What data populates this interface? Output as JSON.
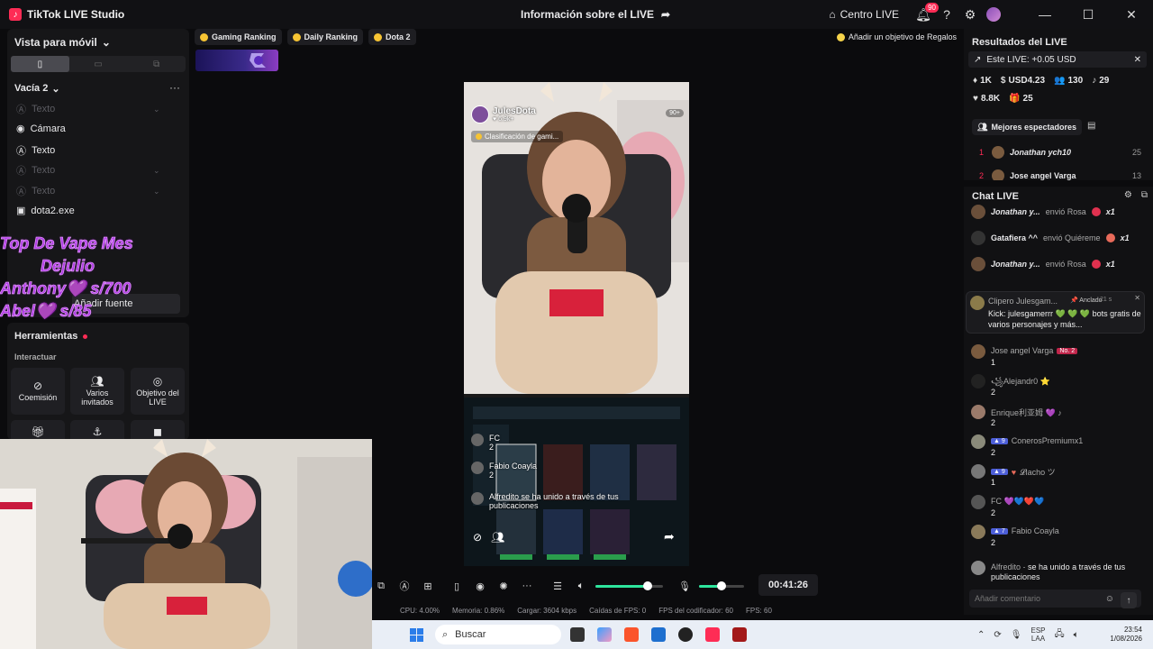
{
  "app": {
    "title": "TikTok LIVE Studio",
    "center_title": "Información sobre el LIVE",
    "home_label": "Centro LIVE",
    "notif_count": "90"
  },
  "left": {
    "view_mode": "Vista para móvil",
    "scene_name": "Vacía 2",
    "sources": [
      {
        "label": "Texto",
        "dim": true
      },
      {
        "label": "Cámara",
        "dim": false
      },
      {
        "label": "Texto",
        "dim": false
      },
      {
        "label": "Texto",
        "dim": true
      },
      {
        "label": "Texto",
        "dim": true
      },
      {
        "label": "dota2.exe",
        "dim": false
      }
    ],
    "add_source": "Añadir fuente",
    "overlay_lines": [
      "Top De Vape  Mes",
      "Dejulio",
      "Anthony💜 s/700",
      "Abel💜      s/85"
    ]
  },
  "tools": {
    "title": "Herramientas",
    "section": "Interactuar",
    "cards": [
      "Coemisión",
      "Varios invitados",
      "Objetivo del LIVE"
    ]
  },
  "goalbar": {
    "chips": [
      "Gaming Ranking",
      "Daily Ranking",
      "Dota 2"
    ],
    "regalos": "Añadir un objetivo de Regalos"
  },
  "preview": {
    "streamer": "JulesDota",
    "likes": "6.9k+",
    "viewers": "90+",
    "ranking": "Clasificación de gami...",
    "chat": [
      {
        "user": "FC",
        "text": "2"
      },
      {
        "user": "Fabio Coayla",
        "text": "2"
      },
      {
        "user": "Alfredito",
        "text": "se ha unido a través de tus publicaciones"
      }
    ]
  },
  "controls": {
    "timer": "00:41:26",
    "volume_level": 0.78,
    "mic_level": 0.5
  },
  "stats": [
    "CPU:  4.00%",
    "Memoria:  0.86%",
    "Cargar:  3604 kbps",
    "Caídas de FPS:  0",
    "FPS del codificador:  60",
    "FPS:  60"
  ],
  "results": {
    "title": "Resultados del LIVE",
    "este_live": "Este LIVE: +0.05 USD",
    "metrics_row1": [
      {
        "icon": "♦",
        "value": "1K"
      },
      {
        "icon": "$",
        "value": "USD4.23"
      },
      {
        "icon": "👥",
        "value": "130"
      },
      {
        "icon": "♪",
        "value": "29"
      }
    ],
    "metrics_row2": [
      {
        "icon": "♥",
        "value": "8.8K"
      },
      {
        "icon": "🎁",
        "value": "25"
      }
    ],
    "top_viewers_label": "Mejores espectadores",
    "top_viewers": [
      {
        "rank": "1",
        "name": "Jonathan ych10",
        "score": "25"
      },
      {
        "rank": "2",
        "name": "Jose angel Varga",
        "score": "13"
      }
    ]
  },
  "chat": {
    "title": "Chat LIVE",
    "gifts": [
      {
        "user": "Jonathan y...",
        "action": "envió Rosa",
        "count": "x1"
      },
      {
        "user": "Gatafiera ^^",
        "action": "envió Quiéreme",
        "count": "x1"
      },
      {
        "user": "Jonathan y...",
        "action": "envió Rosa",
        "count": "x1"
      }
    ],
    "pinned": {
      "user": "Clipero Julesgam...",
      "tag": "Anclado",
      "time": "21 s",
      "text": "Kick: julesgamerrr 💚 💚 💚 bots gratis de varios personajes y más..."
    },
    "messages": [
      {
        "level": "",
        "badge": "No. 2",
        "user": "Jose angel Varga",
        "text": "1"
      },
      {
        "level": "",
        "badge": "",
        "user": "꧁Alejandr0 ⭐",
        "text": "2"
      },
      {
        "level": "",
        "badge": "",
        "user": "Enrique利亚姆 💜 ♪",
        "text": "2"
      },
      {
        "level": "9",
        "badge": "",
        "user": "ConerosPremiumx1",
        "text": "2"
      },
      {
        "level": "9",
        "badge": "",
        "user": "𝓛lacho ツ",
        "text": "1"
      },
      {
        "level": "",
        "badge": "",
        "user": "FC 💜💙❤️💙",
        "text": "2"
      },
      {
        "level": "7",
        "badge": "",
        "user": "Fabio Coayla",
        "text": "2"
      },
      {
        "level": "",
        "badge": "",
        "user": "Alfredito",
        "text": "se ha unido a través de tus publicaciones"
      }
    ],
    "comment_placeholder": "Añadir comentario"
  },
  "taskbar": {
    "search": "Buscar",
    "lang1": "ESP",
    "lang2": "LAA",
    "time": "23:54",
    "date": "1/08/2026"
  }
}
